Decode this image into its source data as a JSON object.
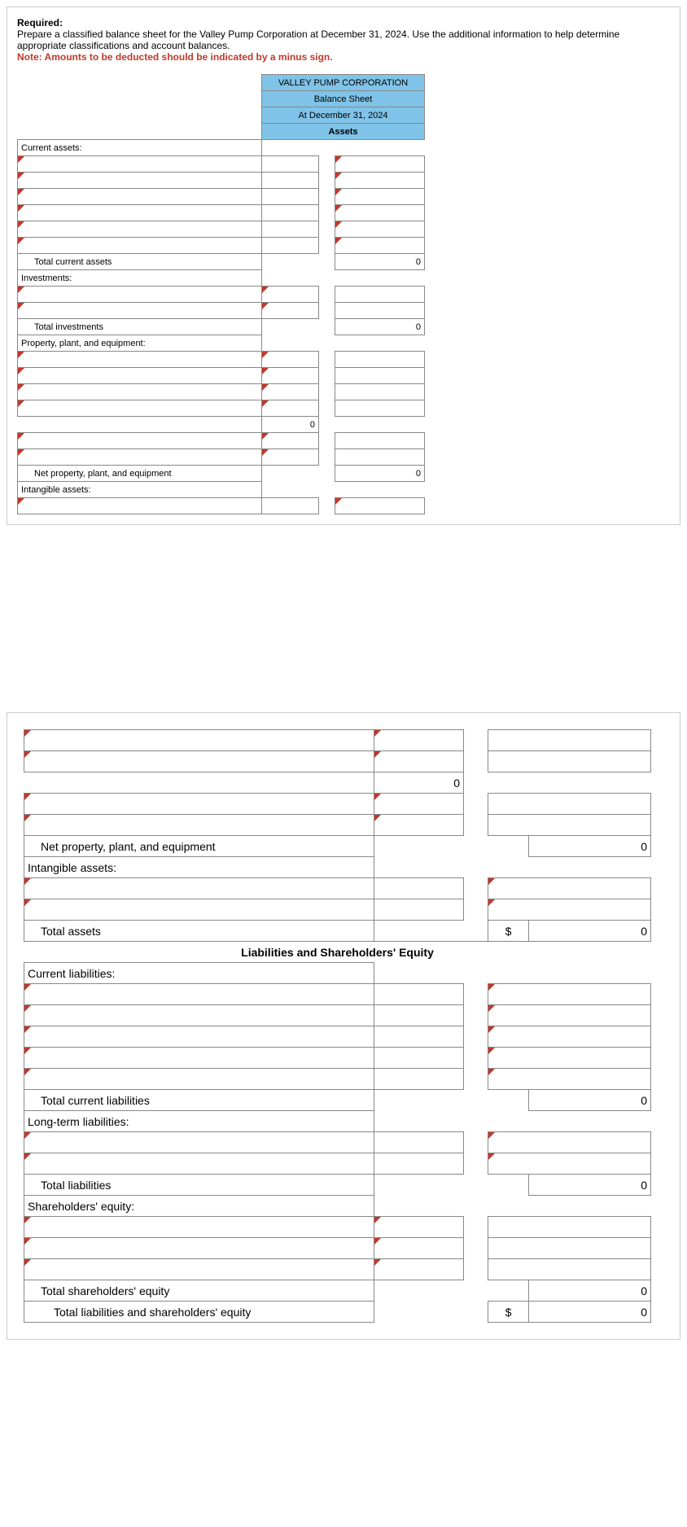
{
  "req": {
    "head": "Required:",
    "body": "Prepare a classified balance sheet for the Valley Pump Corporation at December 31, 2024. Use the additional information to help determine appropriate classifications and account balances.",
    "note": "Note: Amounts to be deducted should be indicated by a minus sign."
  },
  "bs": {
    "h1": "VALLEY PUMP CORPORATION",
    "h2": "Balance Sheet",
    "h3": "At December 31, 2024",
    "h4": "Assets",
    "current_assets": "Current assets:",
    "total_current_assets": "Total current assets",
    "tca_val": "0",
    "investments": "Investments:",
    "total_investments": "Total investments",
    "ti_val": "0",
    "ppe": "Property, plant, and equipment:",
    "ppe_sub_val": "0",
    "net_ppe": "Net property, plant, and equipment",
    "net_ppe_val": "0",
    "intangible": "Intangible assets:"
  },
  "bs2": {
    "sub_val": "0",
    "net_ppe": "Net property, plant, and equipment",
    "net_ppe_val": "0",
    "intangible": "Intangible assets:",
    "total_assets": "Total assets",
    "ta_sym": "$",
    "ta_val": "0",
    "lse_hdr": "Liabilities and Shareholders' Equity",
    "cl": "Current liabilities:",
    "tcl": "Total current liabilities",
    "tcl_val": "0",
    "ltl": "Long-term liabilities:",
    "tl": "Total liabilities",
    "tl_val": "0",
    "se": "Shareholders' equity:",
    "tse": "Total shareholders' equity",
    "tse_val": "0",
    "tlse": "Total liabilities and shareholders' equity",
    "tlse_sym": "$",
    "tlse_val": "0"
  }
}
